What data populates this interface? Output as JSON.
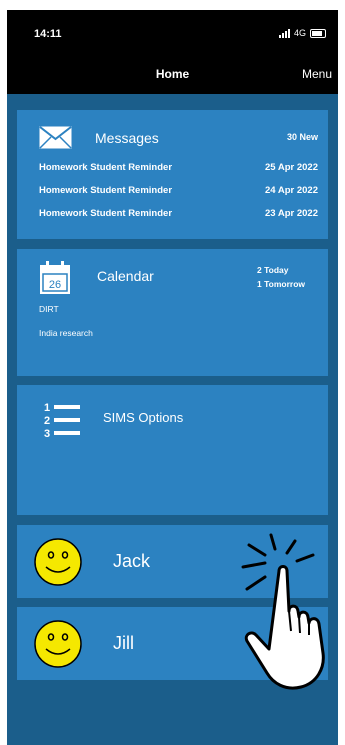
{
  "status": {
    "time": "14:11",
    "network": "4G"
  },
  "nav": {
    "title": "Home",
    "menu": "Menu"
  },
  "messages": {
    "title": "Messages",
    "new_count": "30 New",
    "items": [
      {
        "subject": "Homework Student Reminder",
        "date": "25 Apr 2022"
      },
      {
        "subject": "Homework Student Reminder",
        "date": "24 Apr 2022"
      },
      {
        "subject": "Homework Student Reminder",
        "date": "23 Apr 2022"
      }
    ]
  },
  "calendar": {
    "title": "Calendar",
    "icon_day": "26",
    "today": "2 Today",
    "tomorrow": "1 Tomorrow",
    "event1": "DIRT",
    "event2": "India research"
  },
  "sims": {
    "title": "SIMS Options",
    "icon_numbers": [
      "1",
      "2",
      "3"
    ]
  },
  "people": [
    {
      "name": "Jack",
      "icon": "smiley-icon"
    },
    {
      "name": "Jill",
      "icon": "smiley-icon"
    }
  ],
  "colors": {
    "background": "#1b5e8b",
    "card": "#2c82c1",
    "bar": "#000000",
    "smiley": "#f5e800"
  }
}
